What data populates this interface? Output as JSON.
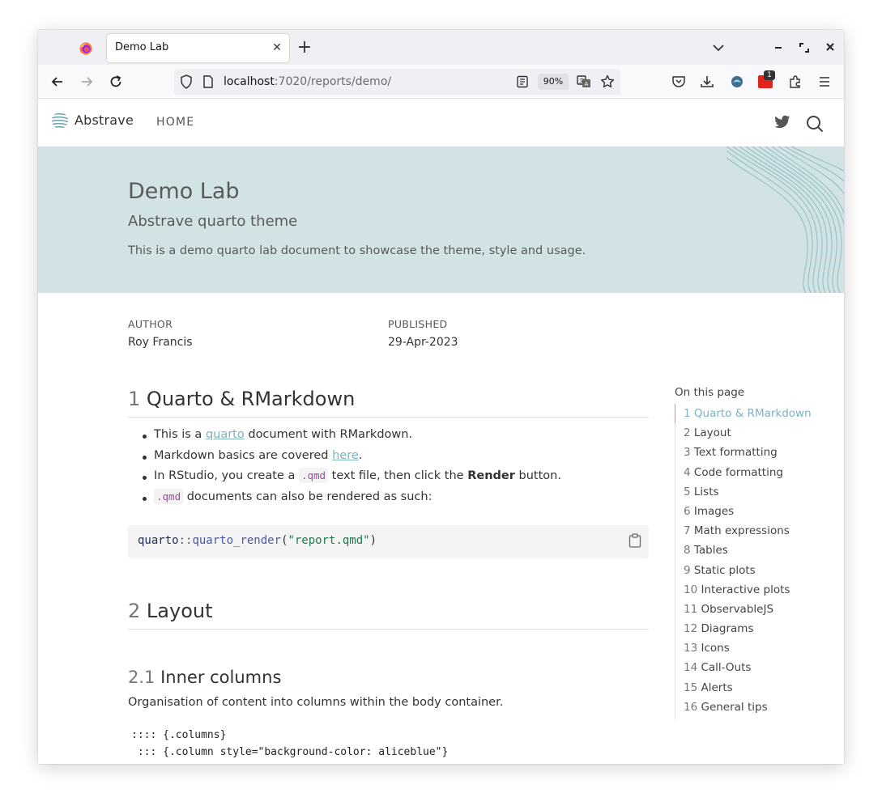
{
  "browser": {
    "tab_title": "Demo Lab",
    "url_host": "localhost",
    "url_rest": ":7020/reports/demo/",
    "zoom": "90%",
    "extension_badge": "1"
  },
  "site": {
    "brand": "Abstrave",
    "nav_home": "HOME"
  },
  "banner": {
    "title": "Demo Lab",
    "subtitle": "Abstrave quarto theme",
    "description": "This is a demo quarto lab document to showcase the theme, style and usage.",
    "bg_color": "#d1e3e4"
  },
  "meta": {
    "author_label": "AUTHOR",
    "author": "Roy Francis",
    "published_label": "PUBLISHED",
    "published": "29-Apr-2023"
  },
  "content": {
    "sec1_num": "1",
    "sec1_title": "Quarto & RMarkdown",
    "b1_pre": "This is a ",
    "b1_link": "quarto",
    "b1_post": " document with RMarkdown.",
    "b2_pre": "Markdown basics are covered ",
    "b2_link": "here",
    "b2_post": ".",
    "b3_pre": "In RStudio, you create a ",
    "b3_code": ".qmd",
    "b3_mid": " text file, then click the ",
    "b3_bold": "Render",
    "b3_post": " button.",
    "b4_code": ".qmd",
    "b4_post": " documents can also be rendered as such:",
    "code_ns": "quarto",
    "code_op": "::",
    "code_fn": "quarto_render",
    "code_open": "(",
    "code_str": "\"report.qmd\"",
    "code_close": ")",
    "sec2_num": "2",
    "sec2_title": "Layout",
    "sub21_num": "2.1",
    "sub21_title": "Inner columns",
    "para_inner": "Organisation of content into columns within the body container.",
    "code_line1": ":::: {.columns}",
    "code_line2": " ::: {.column style=\"background-color: aliceblue\"}"
  },
  "toc": {
    "title": "On this page",
    "items": [
      {
        "n": "1",
        "label": "Quarto & RMarkdown"
      },
      {
        "n": "2",
        "label": "Layout"
      },
      {
        "n": "3",
        "label": "Text formatting"
      },
      {
        "n": "4",
        "label": "Code formatting"
      },
      {
        "n": "5",
        "label": "Lists"
      },
      {
        "n": "6",
        "label": "Images"
      },
      {
        "n": "7",
        "label": "Math expressions"
      },
      {
        "n": "8",
        "label": "Tables"
      },
      {
        "n": "9",
        "label": "Static plots"
      },
      {
        "n": "10",
        "label": "Interactive plots"
      },
      {
        "n": "11",
        "label": "ObservableJS"
      },
      {
        "n": "12",
        "label": "Diagrams"
      },
      {
        "n": "13",
        "label": "Icons"
      },
      {
        "n": "14",
        "label": "Call-Outs"
      },
      {
        "n": "15",
        "label": "Alerts"
      },
      {
        "n": "16",
        "label": "General tips"
      }
    ]
  },
  "colors": {
    "accent": "#7fb3bd",
    "inline_code": "#9a4d9a"
  }
}
